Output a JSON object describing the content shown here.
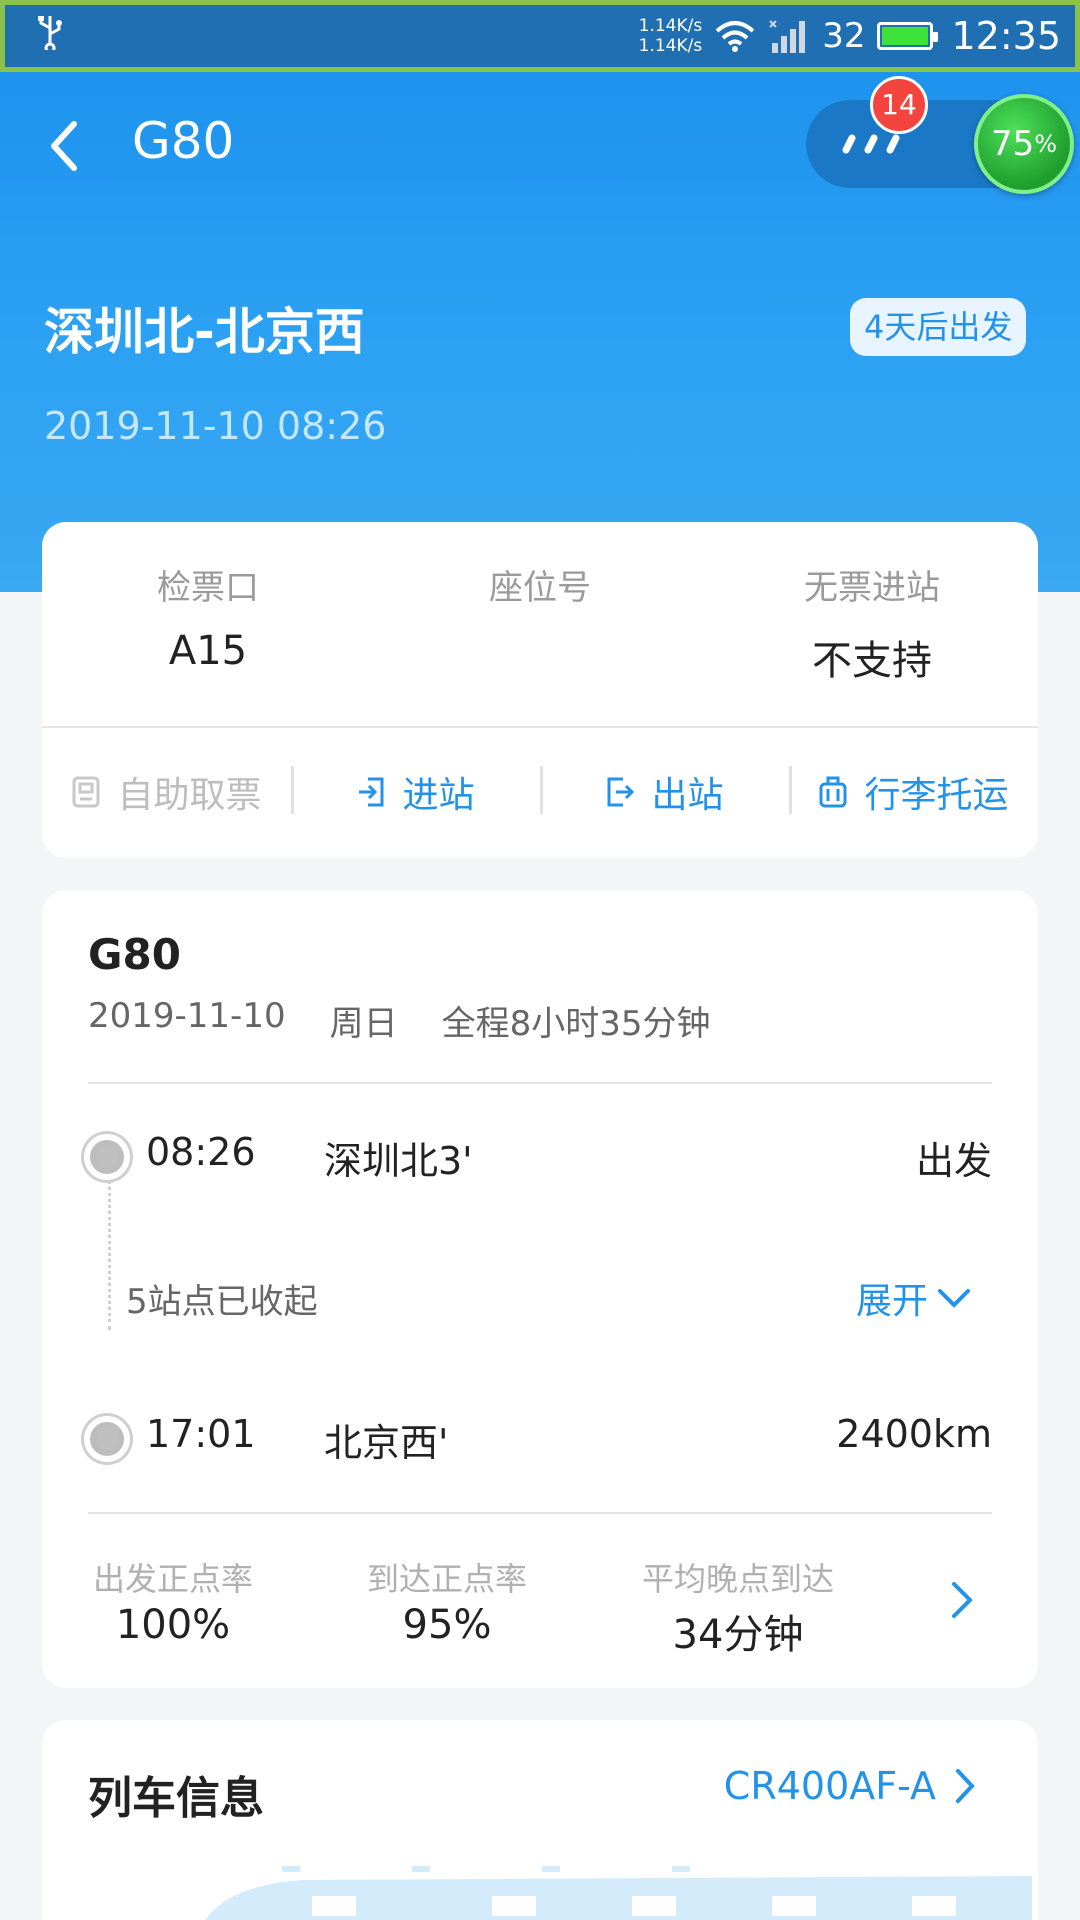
{
  "status_bar": {
    "net_up": "1.14K/s",
    "net_down": "1.14K/s",
    "signal_level": "32",
    "battery_fill": 1.0,
    "time": "12:35"
  },
  "header": {
    "title": "G80",
    "message_badge": "14",
    "progress_value": "75",
    "progress_unit": "%",
    "route": "深圳北-北京西",
    "depart_countdown": "4天后出发",
    "departure_datetime": "2019-11-10 08:26"
  },
  "ticket_info": {
    "gate_label": "检票口",
    "gate_value": "A15",
    "seat_label": "座位号",
    "seat_value": "",
    "ticketless_label": "无票进站",
    "ticketless_value": "不支持"
  },
  "actions": [
    {
      "label": "自助取票",
      "icon": "ticket-kiosk-icon",
      "enabled": false
    },
    {
      "label": "进站",
      "icon": "enter-station-icon",
      "enabled": true
    },
    {
      "label": "出站",
      "icon": "exit-station-icon",
      "enabled": true
    },
    {
      "label": "行李托运",
      "icon": "luggage-icon",
      "enabled": true
    }
  ],
  "trip": {
    "train_number": "G80",
    "date": "2019-11-10",
    "weekday": "周日",
    "duration": "全程8小时35分钟",
    "origin": {
      "time": "08:26",
      "station": "深圳北3'",
      "status": "出发"
    },
    "collapsed_text": "5站点已收起",
    "expand_label": "展开",
    "destination": {
      "time": "17:01",
      "station": "北京西'",
      "distance": "2400km"
    },
    "stats": [
      {
        "label": "出发正点率",
        "value": "100%"
      },
      {
        "label": "到达正点率",
        "value": "95%"
      },
      {
        "label": "平均晚点到达",
        "value": "34分钟"
      }
    ]
  },
  "train_info": {
    "title": "列车信息",
    "model": "CR400AF-A"
  },
  "colors": {
    "primary_blue": "#2393ea",
    "header_blue": "#1e93ee",
    "badge_red": "#f3453d",
    "ring_green": "#1f9e2d"
  }
}
